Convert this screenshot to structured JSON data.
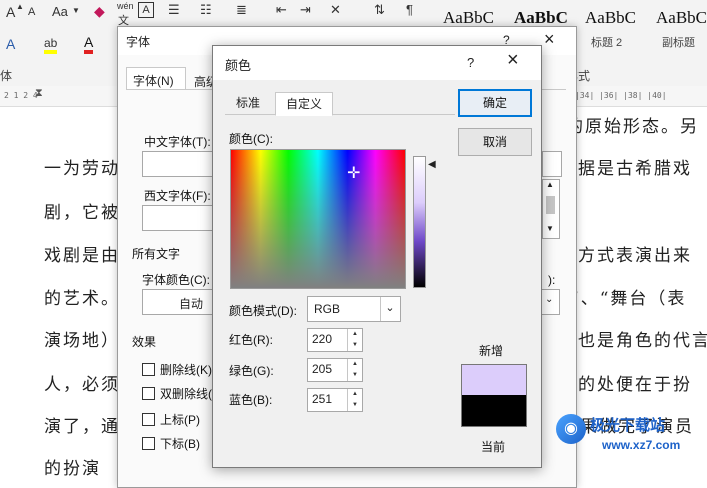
{
  "ribbon": {
    "font_size_up": "A",
    "font_size_down": "A",
    "change_case": "Aa",
    "phonetic": "wén",
    "char_border": "A",
    "styles": [
      {
        "preview": "AaBbC",
        "name": ""
      },
      {
        "preview": "AaBbC",
        "name": ""
      },
      {
        "preview": "AaBbC",
        "name": "标题 2"
      },
      {
        "preview": "AaBbC",
        "name": "副标题"
      }
    ],
    "group_font_label": "体",
    "group_style_label": "样式"
  },
  "ruler": {
    "left": "2 1 2 4",
    "right": "|34| |36| |38| |40|"
  },
  "document": {
    "lines": [
      {
        "left": "",
        "right": "的原始形态。另"
      },
      {
        "left": "一为劳动",
        "right": "据是古希腊戏"
      },
      {
        "left": "剧，它被",
        "right": ""
      },
      {
        "left": "戏剧是由",
        "right": "方式表演出来"
      },
      {
        "left": "的艺术。",
        "right": "”、“舞台（表"
      },
      {
        "left": "演场地）",
        "right": "也是角色的代言"
      },
      {
        "left": "人，必须",
        "right": "的处便在于扮"
      },
      {
        "left": "演了，通",
        "right": "果做完了演员"
      },
      {
        "left": "的扮演",
        "right": ""
      }
    ]
  },
  "font_dialog": {
    "title": "字体",
    "help": "?",
    "close": "×",
    "tabs": [
      "字体(N)",
      "高级"
    ],
    "chinese_font_label": "中文字体(T):",
    "western_font_label": "西文字体(F):",
    "all_text_label": "所有文字",
    "font_color_label": "字体颜色(C):",
    "font_color_value": "自动",
    "effects_label": "效果",
    "effects": [
      "删除线(K)",
      "双删除线(L)",
      "上标(P)",
      "下标(B)"
    ],
    "right_label": "):"
  },
  "color_dialog": {
    "title": "颜色",
    "help": "?",
    "close": "×",
    "tabs": [
      "标准",
      "自定义"
    ],
    "active_tab": "自定义",
    "colors_label": "颜色(C):",
    "color_model_label": "颜色模式(D):",
    "color_model_value": "RGB",
    "red_label": "红色(R):",
    "green_label": "绿色(G):",
    "blue_label": "蓝色(B):",
    "red": "220",
    "green": "205",
    "blue": "251",
    "ok": "确定",
    "cancel": "取消",
    "new_label": "新增",
    "current_label": "当前",
    "new_color": "#dccdfb",
    "current_color": "#000000"
  },
  "watermark": {
    "text": "极光下载站",
    "url": "www.xz7.com"
  }
}
